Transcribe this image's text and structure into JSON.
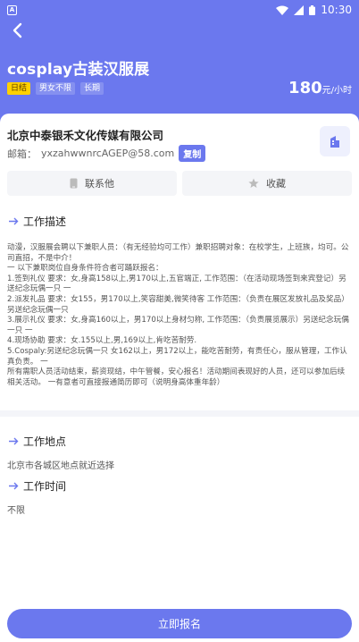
{
  "status_bar": {
    "time": "10:30",
    "left_icon_letter": "A"
  },
  "header": {
    "title": "cosplay古装汉服展",
    "tags": [
      "日结",
      "男女不限",
      "长期"
    ],
    "salary_amount": "180",
    "salary_unit": "元/小时",
    "accent_color": "#6b78ee"
  },
  "company": {
    "name": "北京中泰银禾文化传媒有限公司",
    "email_label": "邮箱：",
    "email": "yxzahwwnrcAGEP@58.com",
    "copy_label": "复制",
    "icon": "building-icon"
  },
  "actions": {
    "contact_label": "联系他",
    "favorite_label": "收藏"
  },
  "sections": {
    "description_title": "工作描述",
    "description_text": "动漫，汉服展会聘以下兼职人员：（有无经验均可工作）兼职招聘对象：在校学生，上班族，均可。公司直招，不是中介！\n一 以下兼职岗位自身条件符合者可踊跃报名：\n1.签到礼仪 要求：女,身高158以上,男170以上,五官端正, 工作范围：（在活动现场签到来宾登记）另送纪念玩偶一只 一\n2.派发礼品 要求：女155，男170以上,笑容甜美,微笑待客 工作范围：（负责在展区发放礼品及奖品）另送纪念玩偶一只\n3.展示礼仪 要求：女,身高160以上，男170以上身材匀称, 工作范围：（负责展览展示）另送纪念玩偶一只 一\n4.现场协助 要求：女.155以上,男,169以上,肯吃苦耐劳.\n5.Cospaly:另送纪念玩偶一只 女162以上，男172以上，能吃苦耐劳，有责任心，服从管理，工作认真负责。 一\n所有需职人员活动结束，薪资现结，中午管餐，安心报名！活动期间表现好的人员，还可以参加后续相关活动。 一有意者可直接报通简历即可（说明身高体重年龄）",
    "location_title": "工作地点",
    "location_text": "北京市各城区地点就近选择",
    "time_title": "工作时间",
    "time_text": "不限"
  },
  "apply_label": "立即报名"
}
